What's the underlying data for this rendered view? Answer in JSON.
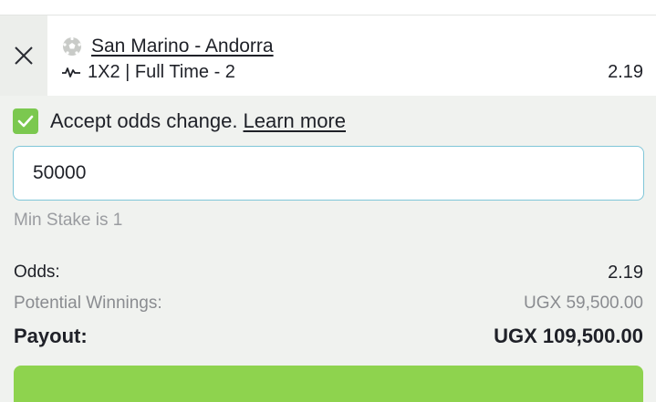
{
  "bet": {
    "match": "San Marino - Andorra",
    "market": "1X2 | Full Time - 2",
    "odds": "2.19"
  },
  "accept_odds": {
    "checked": true,
    "label": "Accept odds change.",
    "learn_more": "Learn more"
  },
  "stake": {
    "value": "50000",
    "min_hint": "Min Stake is 1"
  },
  "summary": {
    "odds_label": "Odds:",
    "odds_value": "2.19",
    "winnings_label": "Potential Winnings:",
    "winnings_value": "UGX 59,500.00",
    "payout_label": "Payout:",
    "payout_value": "UGX 109,500.00"
  },
  "icons": {
    "close": "close-icon",
    "ball": "football-icon",
    "market": "pulse-icon",
    "check": "checkmark-icon"
  },
  "colors": {
    "accent_green": "#7bc84f",
    "input_border": "#7fc6d8",
    "background": "#f0f2ef"
  }
}
